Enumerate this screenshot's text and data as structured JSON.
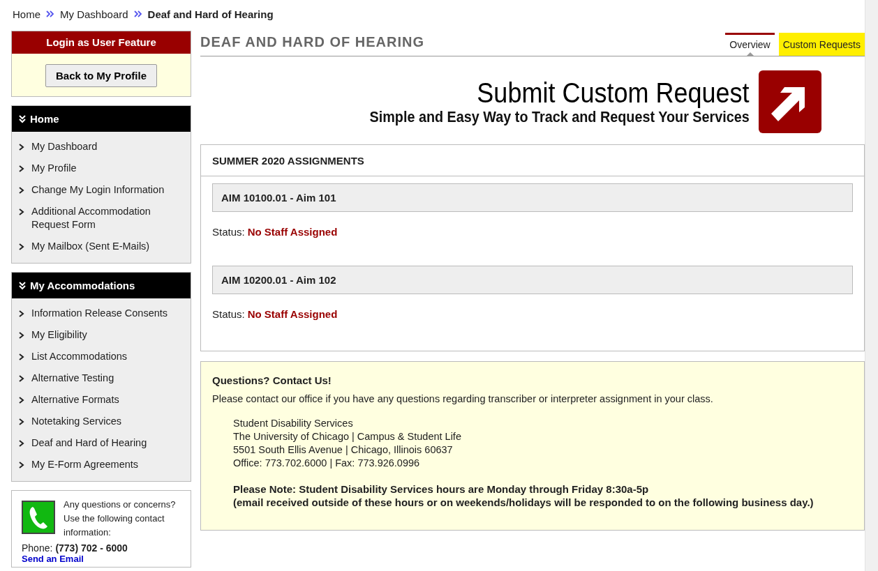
{
  "breadcrumb": [
    {
      "label": "Home",
      "current": false
    },
    {
      "label": "My Dashboard",
      "current": false
    },
    {
      "label": "Deaf and Hard of Hearing",
      "current": true
    }
  ],
  "login_panel": {
    "title": "Login as User Feature",
    "button": "Back to My Profile"
  },
  "sidebar": {
    "sections": [
      {
        "title": "Home",
        "items": [
          "My Dashboard",
          "My Profile",
          "Change My Login Information",
          "Additional Accommodation Request Form",
          "My Mailbox (Sent E-Mails)"
        ]
      },
      {
        "title": "My Accommodations",
        "items": [
          "Information Release Consents",
          "My Eligibility",
          "List Accommodations",
          "Alternative Testing",
          "Alternative Formats",
          "Notetaking Services",
          "Deaf and Hard of Hearing",
          "My E-Form Agreements"
        ]
      }
    ],
    "contact": {
      "text": "Any questions or concerns? Use the following contact information:",
      "phone_label": "Phone:",
      "phone": "(773) 702 - 6000",
      "email_link": "Send an Email"
    }
  },
  "page": {
    "title": "DEAF AND HARD OF HEARING",
    "tabs": [
      {
        "label": "Overview",
        "selected": true,
        "highlighted": false
      },
      {
        "label": "Custom Requests",
        "selected": false,
        "highlighted": true
      }
    ],
    "banner": {
      "title": "Submit Custom Request",
      "subtitle": "Simple and Easy Way to Track and Request Your Services"
    },
    "assignments": {
      "title": "SUMMER 2020 ASSIGNMENTS",
      "courses": [
        {
          "name": "AIM 10100.01 - Aim 101",
          "status_label": "Status:",
          "status": "No Staff Assigned"
        },
        {
          "name": "AIM 10200.01 - Aim 102",
          "status_label": "Status:",
          "status": "No Staff Assigned"
        }
      ]
    },
    "contact_box": {
      "title": "Questions? Contact Us!",
      "intro": "Please contact our office if you have any questions regarding transcriber or interpreter assignment in your class.",
      "address": [
        "Student Disability Services",
        "The University of Chicago | Campus & Student Life",
        "5501 South Ellis Avenue | Chicago, Illinois 60637",
        "Office: 773.702.6000 | Fax: 773.926.0996"
      ],
      "note": [
        "Please Note: Student Disability Services hours are Monday through Friday 8:30a-5p",
        "(email received outside of these hours or on weekends/holidays will be responded to on the following business day.)"
      ]
    }
  }
}
